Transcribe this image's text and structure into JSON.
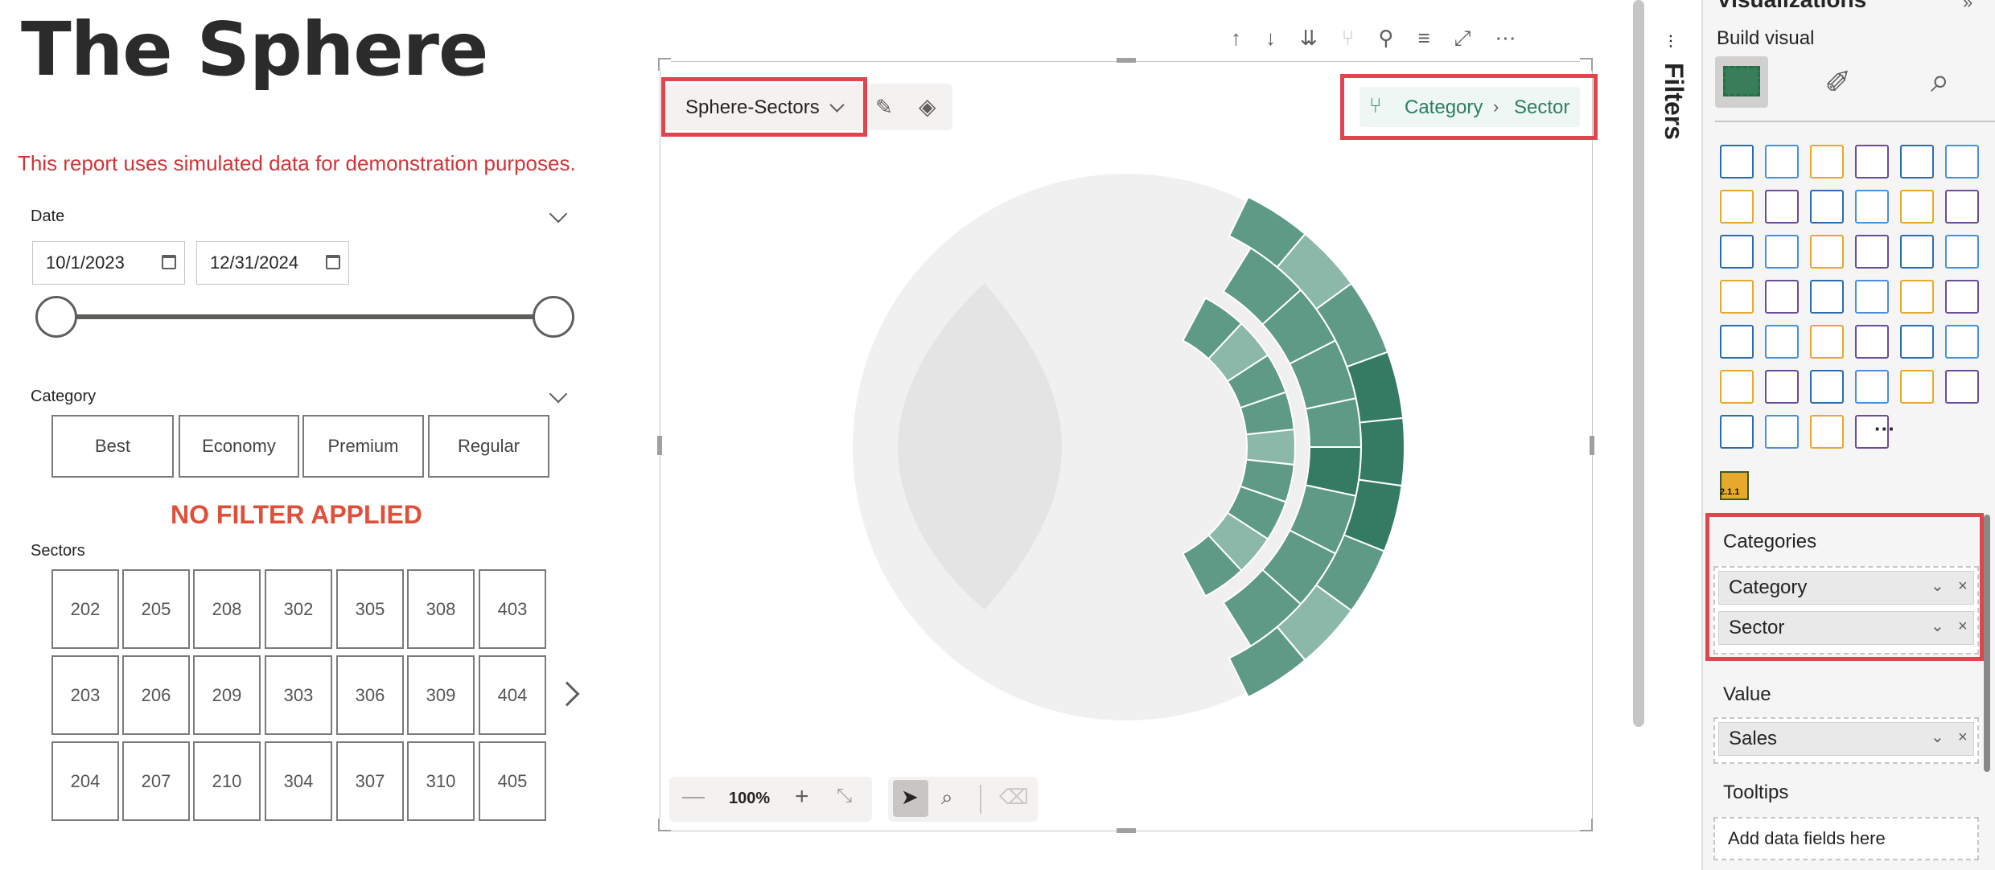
{
  "report": {
    "title": "The Sphere",
    "subtitle": "This report uses simulated data for demonstration purposes."
  },
  "date_slicer": {
    "label": "Date",
    "start": "10/1/2023",
    "end": "12/31/2024"
  },
  "category_slicer": {
    "label": "Category",
    "options": [
      "Best",
      "Economy",
      "Premium",
      "Regular"
    ]
  },
  "filter_status": "NO FILTER APPLIED",
  "sectors_slicer": {
    "label": "Sectors",
    "rows": [
      [
        "202",
        "205",
        "208",
        "302",
        "305",
        "308",
        "403"
      ],
      [
        "203",
        "206",
        "209",
        "303",
        "306",
        "309",
        "404"
      ],
      [
        "204",
        "207",
        "210",
        "304",
        "307",
        "310",
        "405"
      ]
    ]
  },
  "visual": {
    "map_selector": "Sphere-Sectors",
    "hierarchy": [
      "Category",
      "Sector"
    ],
    "zoom": "100%",
    "colors": {
      "light": "#8cb8a9",
      "mid": "#5f9a86",
      "dark": "#357a63",
      "bowl": "#f0f0f0",
      "stage": "#e4e4e4"
    }
  },
  "filters_pane": {
    "label": "Filters"
  },
  "viz_pane": {
    "title": "Visualizations",
    "build_visual": "Build visual",
    "wells": {
      "categories_label": "Categories",
      "categories": [
        "Category",
        "Sector"
      ],
      "value_label": "Value",
      "values": [
        "Sales"
      ],
      "tooltips_label": "Tooltips",
      "tooltips_placeholder": "Add data fields here"
    },
    "version_badge": "2.1.1",
    "more": "···"
  }
}
